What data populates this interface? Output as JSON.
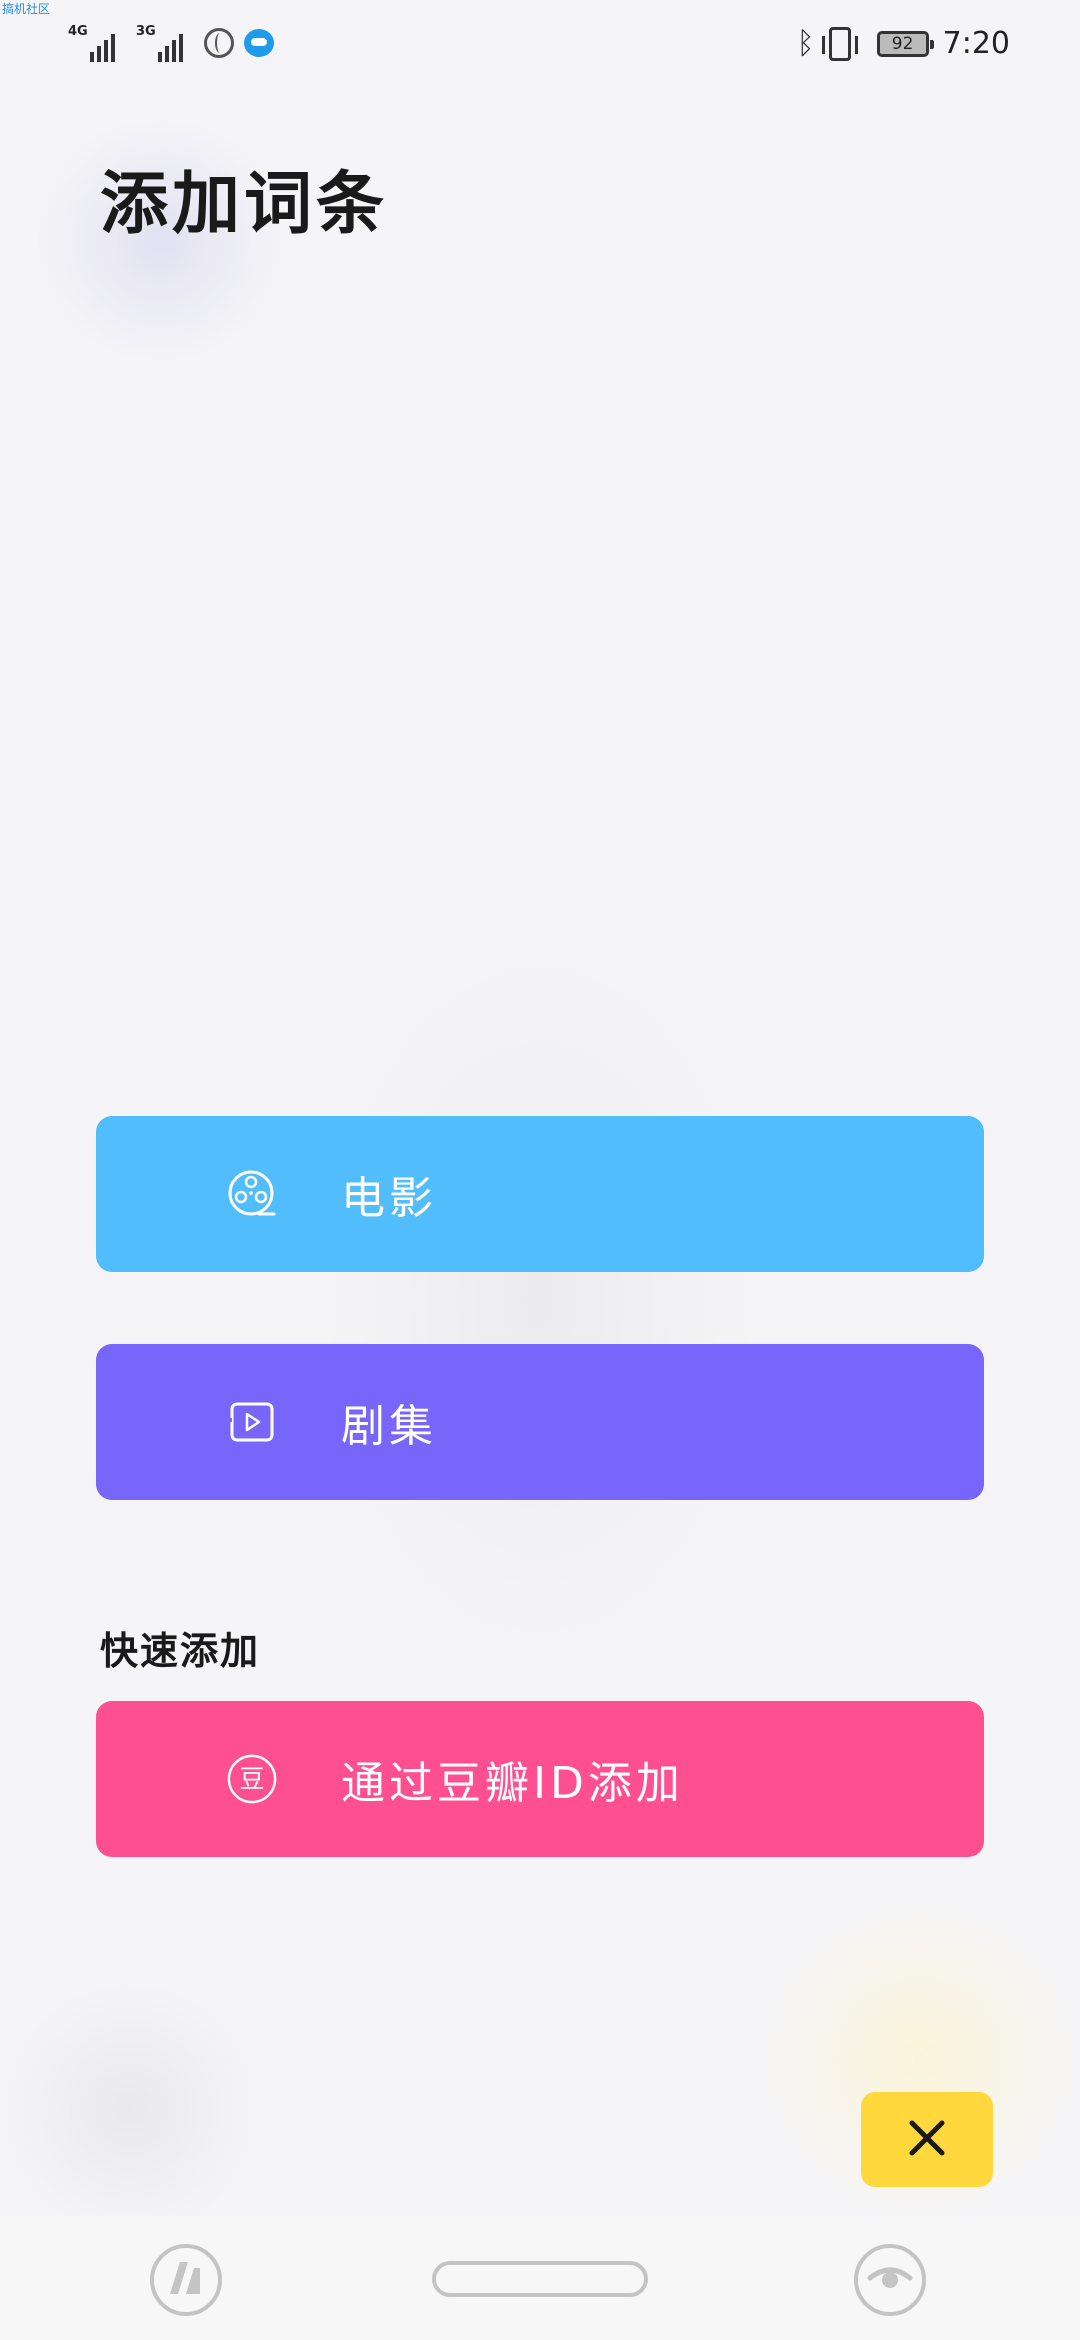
{
  "watermark": "搞机社区",
  "status_bar": {
    "signal1_label": "4G",
    "signal2_label": "3G",
    "battery": "92",
    "time": "7:20"
  },
  "header": {
    "title": "添加词条"
  },
  "actions": [
    {
      "label": "电影",
      "icon": "film-reel-icon",
      "color": "#52bdfc"
    },
    {
      "label": "剧集",
      "icon": "play-screen-icon",
      "color": "#7866fb"
    }
  ],
  "quick_add": {
    "section_title": "快速添加",
    "douban": {
      "label": "通过豆瓣ID添加",
      "icon_glyph": "豆",
      "color": "#fe5091"
    }
  },
  "close": {
    "icon": "close-icon",
    "color": "#ffd83d"
  },
  "nav_bar": {
    "left_icon": "app-logo-icon",
    "right_icon": "eye-icon"
  }
}
